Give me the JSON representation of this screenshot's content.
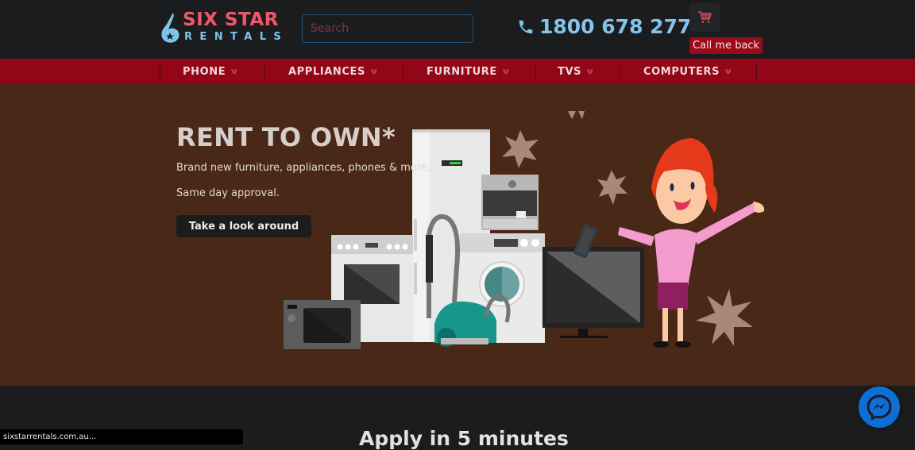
{
  "header": {
    "logo": {
      "line1": "SIX STAR",
      "line2": "RENTALS",
      "icon": "six-star-logo-icon"
    },
    "search": {
      "placeholder": "Search",
      "value": ""
    },
    "phone": {
      "icon": "phone-icon",
      "number": "1800 678 277"
    },
    "cart": {
      "icon": "shopping-cart-icon"
    },
    "callback_label": "Call me back"
  },
  "nav": {
    "items": [
      {
        "label": "PHONE",
        "icon": "chevron-down-icon"
      },
      {
        "label": "APPLIANCES",
        "icon": "chevron-down-icon"
      },
      {
        "label": "FURNITURE",
        "icon": "chevron-down-icon"
      },
      {
        "label": "TVS",
        "icon": "chevron-down-icon"
      },
      {
        "label": "COMPUTERS",
        "icon": "chevron-down-icon"
      }
    ]
  },
  "hero": {
    "title": "RENT TO OWN*",
    "subtitle1": "Brand new furniture, appliances, phones & more.",
    "subtitle2": "Same day approval.",
    "cta_label": "Take a look around",
    "illustration": "appliances-and-woman-illustration"
  },
  "apply": {
    "title": "Apply in 5 minutes"
  },
  "status_bar": {
    "text": "sixstarrentals.com.au..."
  },
  "messenger": {
    "icon": "messenger-icon"
  },
  "colors": {
    "header_bg": "#1b1c1e",
    "nav_bg": "#920617",
    "hero_bg": "#4a2818",
    "brand_pink": "#f0586a",
    "brand_blue": "#7cc4ee",
    "callback_bg": "#9a0a1a",
    "messenger_blue": "#0d6ed6"
  }
}
